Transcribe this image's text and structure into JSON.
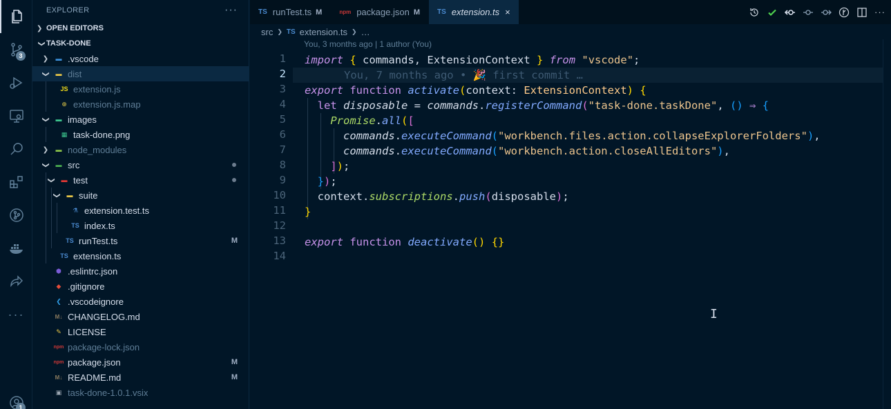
{
  "activity": {
    "scm_badge": "3",
    "account_badge": "1"
  },
  "sidebar": {
    "title": "EXPLORER",
    "more": "···",
    "open_editors": "OPEN EDITORS",
    "project": "TASK-DONE",
    "tree": [
      {
        "label": ".vscode",
        "type": "folder",
        "depth": 1,
        "open": false
      },
      {
        "label": "dist",
        "type": "folder",
        "depth": 1,
        "open": true,
        "dim": true,
        "selected": true
      },
      {
        "label": "extension.js",
        "type": "js",
        "depth": 2,
        "dim": true
      },
      {
        "label": "extension.js.map",
        "type": "map",
        "depth": 2,
        "dim": true
      },
      {
        "label": "images",
        "type": "folder",
        "depth": 1,
        "open": true
      },
      {
        "label": "task-done.png",
        "type": "img",
        "depth": 2
      },
      {
        "label": "node_modules",
        "type": "folder",
        "depth": 1,
        "open": false,
        "dim": true
      },
      {
        "label": "src",
        "type": "folder",
        "depth": 1,
        "open": true,
        "dot": true
      },
      {
        "label": "test",
        "type": "folder",
        "depth": 2,
        "open": true,
        "dot": true
      },
      {
        "label": "suite",
        "type": "folder",
        "depth": 3,
        "open": true
      },
      {
        "label": "extension.test.ts",
        "type": "test",
        "depth": 4
      },
      {
        "label": "index.ts",
        "type": "ts",
        "depth": 4
      },
      {
        "label": "runTest.ts",
        "type": "ts",
        "depth": 3,
        "deco": "M"
      },
      {
        "label": "extension.ts",
        "type": "ts",
        "depth": 2
      },
      {
        "label": ".eslintrc.json",
        "type": "eslint",
        "depth": 1
      },
      {
        "label": ".gitignore",
        "type": "git",
        "depth": 1
      },
      {
        "label": ".vscodeignore",
        "type": "vscode",
        "depth": 1
      },
      {
        "label": "CHANGELOG.md",
        "type": "md",
        "depth": 1
      },
      {
        "label": "LICENSE",
        "type": "license",
        "depth": 1
      },
      {
        "label": "package-lock.json",
        "type": "npm",
        "depth": 1,
        "dim": true
      },
      {
        "label": "package.json",
        "type": "npm",
        "depth": 1,
        "deco": "M"
      },
      {
        "label": "README.md",
        "type": "md",
        "depth": 1,
        "deco": "M"
      },
      {
        "label": "task-done-1.0.1.vsix",
        "type": "vsix",
        "depth": 1,
        "dim": true
      }
    ]
  },
  "tabs": [
    {
      "label": "runTest.ts",
      "icon": "TS",
      "mod": "M",
      "active": false
    },
    {
      "label": "package.json",
      "icon": "npm",
      "mod": "M",
      "active": false
    },
    {
      "label": "extension.ts",
      "icon": "TS",
      "mod": "",
      "active": true,
      "close": "×"
    }
  ],
  "breadcrumbs": {
    "folder": "src",
    "file_icon": "TS",
    "file": "extension.ts",
    "more": "…"
  },
  "editor": {
    "blame_header": "You, 3 months ago | 1 author (You)",
    "inline_blame": "You, 7 months ago • 🎉 first commit …",
    "current_line": 2,
    "line_numbers": [
      "1",
      "2",
      "3",
      "4",
      "5",
      "6",
      "7",
      "8",
      "9",
      "10",
      "11",
      "12",
      "13",
      "14"
    ],
    "strings": {
      "import_from": "\"vscode\"",
      "command_id": "\"task-done.taskDone\"",
      "cmd1": "\"workbench.files.action.collapseExplorerFolders\"",
      "cmd2": "\"workbench.action.closeAllEditors\""
    }
  }
}
